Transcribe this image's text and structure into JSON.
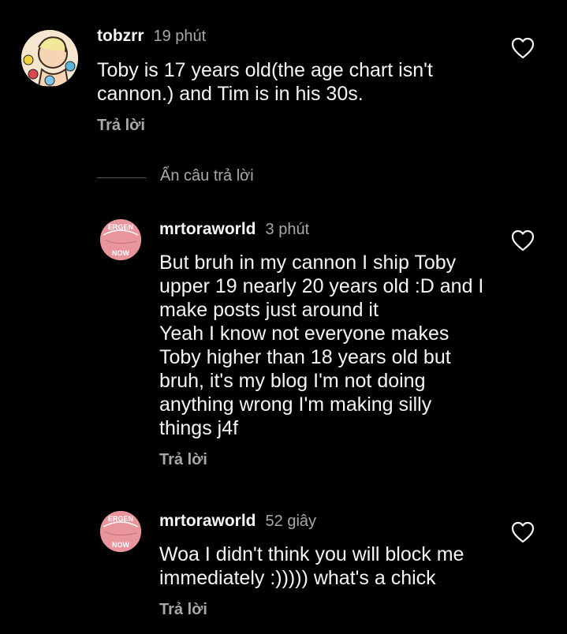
{
  "comments": [
    {
      "username": "tobzrr",
      "time": "19 phút",
      "text": "Toby is 17 years old(the age chart isn't\ncannon.) and Tim is in his 30s.",
      "reply_label": "Trả lời"
    },
    {
      "username": "mrtoraworld",
      "time": "3 phút",
      "text": "But bruh in my cannon I ship Toby\nupper 19 nearly 20 years old :D and I\nmake posts just around it\nYeah I know not everyone makes\nToby higher than 18 years old but\nbruh, it's my blog I'm not doing\nanything wrong I'm making silly\nthings j4f",
      "reply_label": "Trả lời"
    },
    {
      "username": "mrtoraworld",
      "time": "52 giây",
      "text": "Woa I didn't think you will block me\nimmediately :))))) what's a chick",
      "reply_label": "Trả lời"
    }
  ],
  "hide_replies_label": "Ẩn câu trả lời",
  "avatar_texts": {
    "top": "ERGEN",
    "bottom": "NOW"
  },
  "colors": {
    "background": "#000000",
    "text": "#f5f5f5",
    "secondary": "#a8a8a8",
    "avatar_pink": "#e8959b"
  },
  "icons": {
    "like": "heart-outline-icon"
  }
}
